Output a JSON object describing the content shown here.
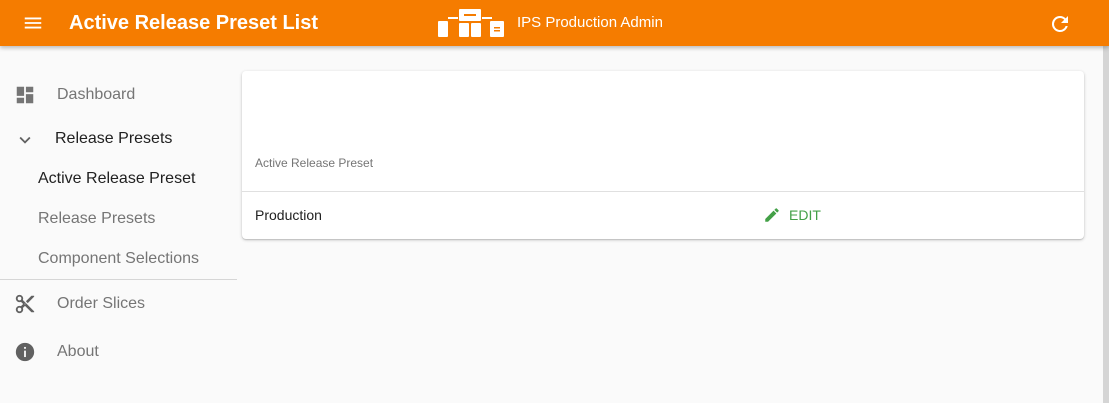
{
  "header": {
    "title": "Active Release Preset List",
    "brand": "IPS Production Admin",
    "color": "#f57c00"
  },
  "sidebar": {
    "dashboard": "Dashboard",
    "release_presets_group": "Release Presets",
    "sub_items": [
      "Active Release Preset",
      "Release Presets",
      "Component Selections"
    ],
    "active_sub_item": "Active Release Preset",
    "order_slices": "Order Slices",
    "about": "About"
  },
  "main": {
    "table_title": "Active Release Preset",
    "rows": [
      {
        "name": "Production",
        "action": "EDIT"
      }
    ]
  },
  "colors": {
    "accent": "#f57c00",
    "edit": "#43a047"
  }
}
